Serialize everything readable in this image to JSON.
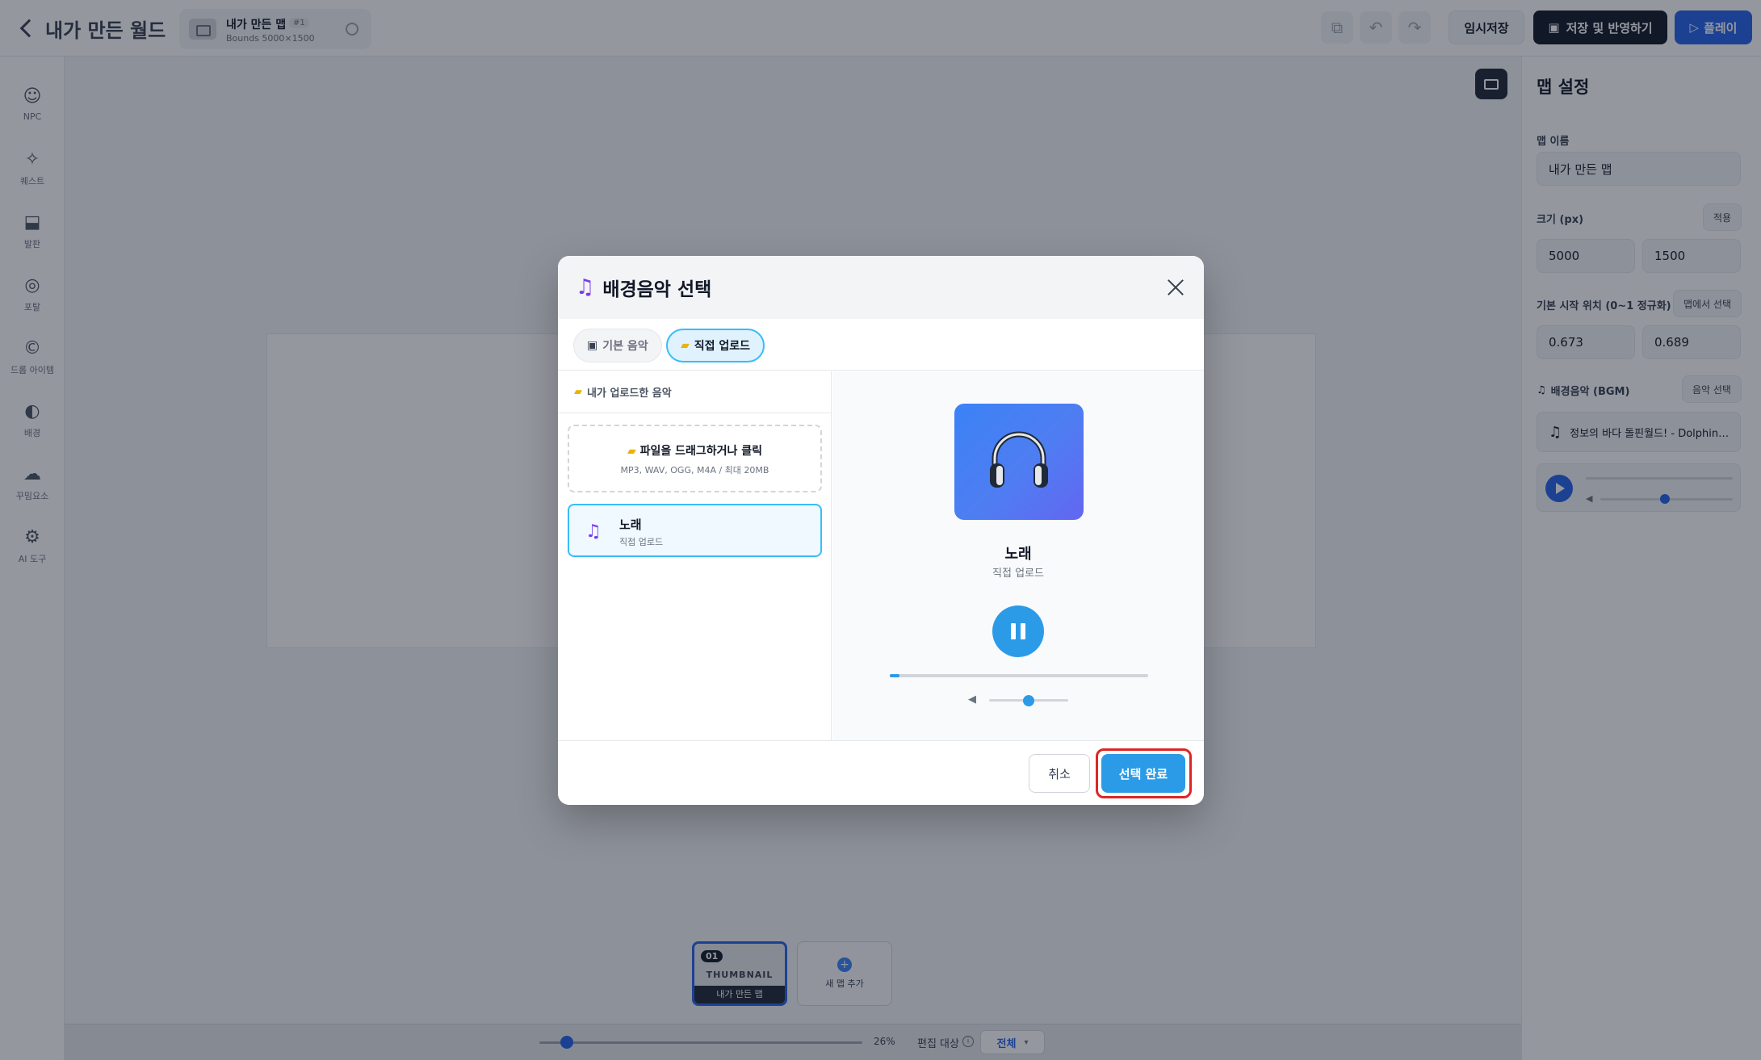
{
  "header": {
    "back_label": "내가 만든 월드",
    "map_chip": {
      "name": "내가 만든 맵",
      "index": "#1",
      "bounds": "Bounds 5000×1500"
    },
    "draft_label": "임시저장",
    "save_label": "저장 및 반영하기",
    "play_label": "플레이"
  },
  "left_tools": [
    {
      "label": "NPC",
      "icon": "npc-icon",
      "glyph": "☺"
    },
    {
      "label": "퀘스트",
      "icon": "sparkle-icon",
      "glyph": "✧"
    },
    {
      "label": "발판",
      "icon": "platform-icon",
      "glyph": "⬓"
    },
    {
      "label": "포탈",
      "icon": "portal-icon",
      "glyph": "◎"
    },
    {
      "label": "드롭 아이템",
      "icon": "coin-icon",
      "glyph": "©"
    },
    {
      "label": "배경",
      "icon": "palette-icon",
      "glyph": "◐"
    },
    {
      "label": "꾸밈요소",
      "icon": "cloud-icon",
      "glyph": "☁"
    },
    {
      "label": "AI 도구",
      "icon": "robot-icon",
      "glyph": "⚙"
    }
  ],
  "canvas": {
    "thumbnail": {
      "number": "01",
      "title": "THUMBNAIL",
      "name": "내가 만든 맵"
    },
    "add_map_label": "새 맵 추가",
    "zoom": "26%",
    "zoom_fraction": 0.26,
    "edit_target_label": "편집 대상",
    "edit_target_value": "전체"
  },
  "right_panel": {
    "title": "맵 설정",
    "map_name_label": "맵 이름",
    "map_name_value": "내가 만든 맵",
    "size_label": "크기 (px)",
    "apply_label": "적용",
    "width_value": "5000",
    "height_value": "1500",
    "start_pos_label": "기본 시작 위치 (0~1 정규화)",
    "pick_on_map_label": "맵에서 선택",
    "start_x": "0.673",
    "start_y": "0.689",
    "bgm_label": "배경음악 (BGM)",
    "music_select_label": "음악 선택",
    "bgm_track": "정보의 바다 돌핀월드! - Dolphin…"
  },
  "modal": {
    "title": "배경음악 선택",
    "tabs": {
      "default_label": "기본 음악",
      "upload_label": "직접 업로드"
    },
    "section_title": "내가 업로드한 음악",
    "dropzone": {
      "title": "파일을 드래그하거나 클릭",
      "subtitle": "MP3, WAV, OGG, M4A / 최대 20MB"
    },
    "track": {
      "name": "노래",
      "source": "직접 업로드"
    },
    "preview": {
      "name": "노래",
      "source": "직접 업로드",
      "progress": 0.03,
      "volume": 0.5
    },
    "cancel_label": "취소",
    "confirm_label": "선택 완료"
  },
  "colors": {
    "accent": "#2b9be8",
    "highlight": "#dc2626",
    "primary_dark": "#111827"
  }
}
